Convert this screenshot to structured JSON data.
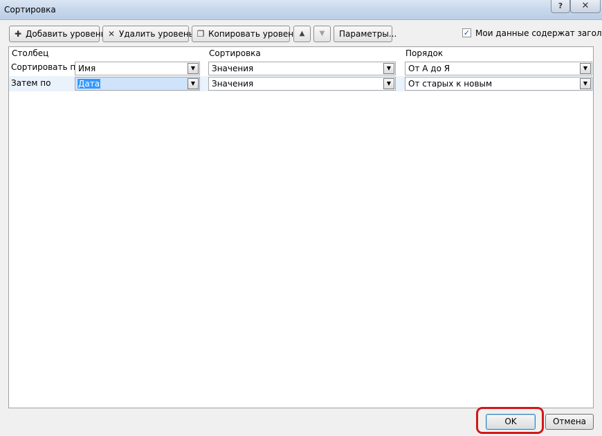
{
  "window": {
    "title": "Сортировка",
    "help_glyph": "?",
    "close_glyph": "✕"
  },
  "toolbar": {
    "add_level": "Добавить уровень",
    "delete_level": "Удалить уровень",
    "copy_level": "Копировать уровень",
    "options": "Параметры...",
    "up_glyph": "▲",
    "down_glyph": "▼",
    "headers_checkbox": {
      "label": "Мои данные содержат заголовки",
      "checked": true,
      "glyph": "✓"
    }
  },
  "columns": {
    "column": "Столбец",
    "sort_on": "Сортировка",
    "order": "Порядок"
  },
  "rows": [
    {
      "label": "Сортировать по",
      "column": "Имя",
      "sort_on": "Значения",
      "order": "От А до Я"
    },
    {
      "label": "Затем по",
      "column": "Дата",
      "sort_on": "Значения",
      "order": "От старых к новым"
    }
  ],
  "footer": {
    "ok": "OK",
    "cancel": "Отмена"
  },
  "icons": {
    "add": "add-level-icon",
    "delete": "delete-x-icon",
    "copy": "copy-icon",
    "dropdown": "chevron-down-icon"
  },
  "colors": {
    "highlight": "#d11818",
    "selection": "#3399ff",
    "checkmark": "#1b4f9c"
  }
}
